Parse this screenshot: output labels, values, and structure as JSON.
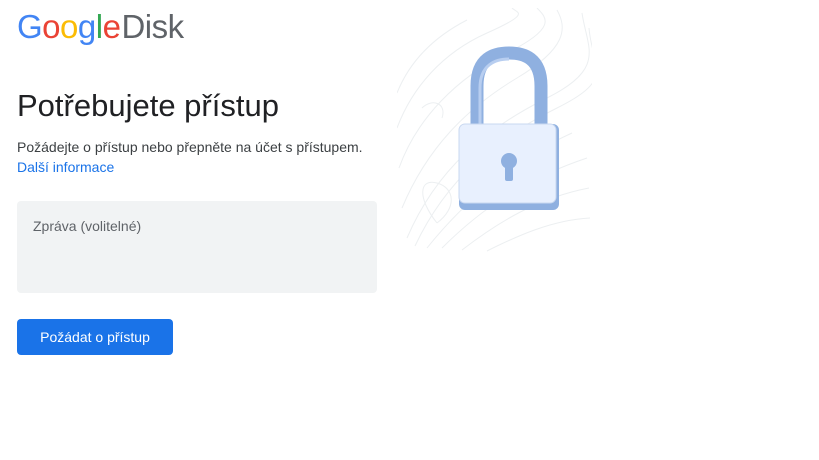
{
  "logo": {
    "g": "G",
    "o1": "o",
    "o2": "o",
    "g2": "g",
    "l": "l",
    "e": "e",
    "product": "Disk"
  },
  "page_title": "Potřebujete přístup",
  "description": "Požádejte o přístup nebo přepněte na účet s přístupem.",
  "learn_more": "Další informace",
  "message_field": {
    "placeholder": "Zpráva (volitelné)",
    "value": ""
  },
  "request_button": "Požádat o přístup",
  "illustration": {
    "icon": "padlock-icon"
  },
  "colors": {
    "primary": "#1a73e8",
    "text": "#202124",
    "secondary_text": "#3c4043",
    "field_bg": "#f1f3f4"
  }
}
